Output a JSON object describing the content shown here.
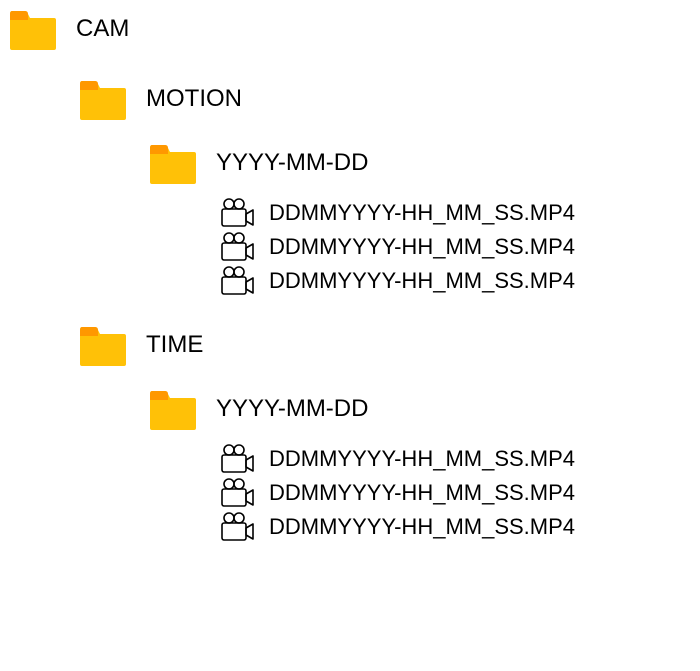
{
  "root": {
    "label": "CAM"
  },
  "sections": [
    {
      "label": "MOTION",
      "date": {
        "label": "YYYY-MM-DD"
      },
      "files": [
        {
          "label": "DDMMYYYY-HH_MM_SS.MP4"
        },
        {
          "label": "DDMMYYYY-HH_MM_SS.MP4"
        },
        {
          "label": "DDMMYYYY-HH_MM_SS.MP4"
        }
      ]
    },
    {
      "label": "TIME",
      "date": {
        "label": "YYYY-MM-DD"
      },
      "files": [
        {
          "label": "DDMMYYYY-HH_MM_SS.MP4"
        },
        {
          "label": "DDMMYYYY-HH_MM_SS.MP4"
        },
        {
          "label": "DDMMYYYY-HH_MM_SS.MP4"
        }
      ]
    }
  ]
}
